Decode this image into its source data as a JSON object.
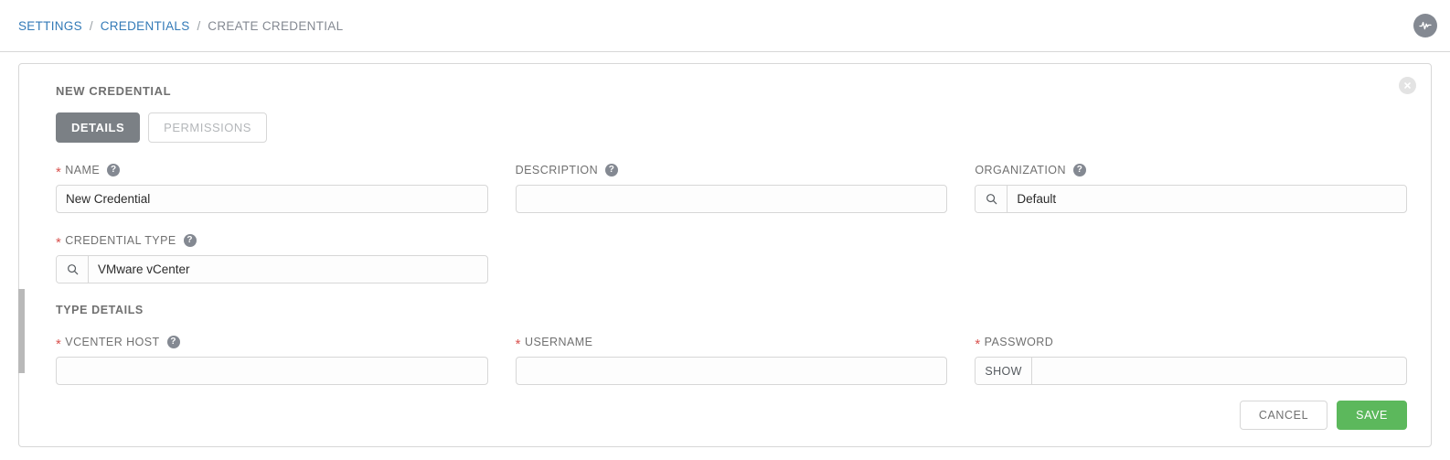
{
  "breadcrumb": {
    "separator": "/",
    "items": [
      {
        "label": "SETTINGS",
        "current": false
      },
      {
        "label": "CREDENTIALS",
        "current": false
      },
      {
        "label": "CREATE CREDENTIAL",
        "current": true
      }
    ]
  },
  "topbar": {
    "activity_icon": "activity-pulse-icon"
  },
  "panel": {
    "title": "NEW CREDENTIAL",
    "close_icon": "close-icon",
    "tabs": [
      {
        "label": "DETAILS",
        "active": true
      },
      {
        "label": "PERMISSIONS",
        "active": false
      }
    ]
  },
  "form": {
    "name": {
      "label": "NAME",
      "required": true,
      "help": true,
      "value": "New Credential",
      "placeholder": ""
    },
    "description": {
      "label": "DESCRIPTION",
      "required": false,
      "help": true,
      "value": "",
      "placeholder": ""
    },
    "organization": {
      "label": "ORGANIZATION",
      "required": false,
      "help": true,
      "value": "Default",
      "placeholder": "",
      "addon_icon": "search-icon"
    },
    "credential_type": {
      "label": "CREDENTIAL TYPE",
      "required": true,
      "help": true,
      "value": "VMware vCenter",
      "placeholder": "",
      "addon_icon": "search-icon"
    }
  },
  "type_details": {
    "heading": "TYPE DETAILS",
    "vcenter_host": {
      "label": "VCENTER HOST",
      "required": true,
      "help": true,
      "value": "",
      "placeholder": ""
    },
    "username": {
      "label": "USERNAME",
      "required": true,
      "help": false,
      "value": "",
      "placeholder": ""
    },
    "password": {
      "label": "PASSWORD",
      "required": true,
      "help": false,
      "value": "",
      "placeholder": "",
      "addon_label": "SHOW"
    }
  },
  "footer": {
    "cancel_label": "CANCEL",
    "save_label": "SAVE"
  },
  "colors": {
    "link": "#337ab7",
    "tab_active_bg": "#7b8085",
    "save_bg": "#5cb85c",
    "required_asterisk": "#d9534f",
    "label_text": "#707070",
    "border": "#d7d7d7"
  }
}
